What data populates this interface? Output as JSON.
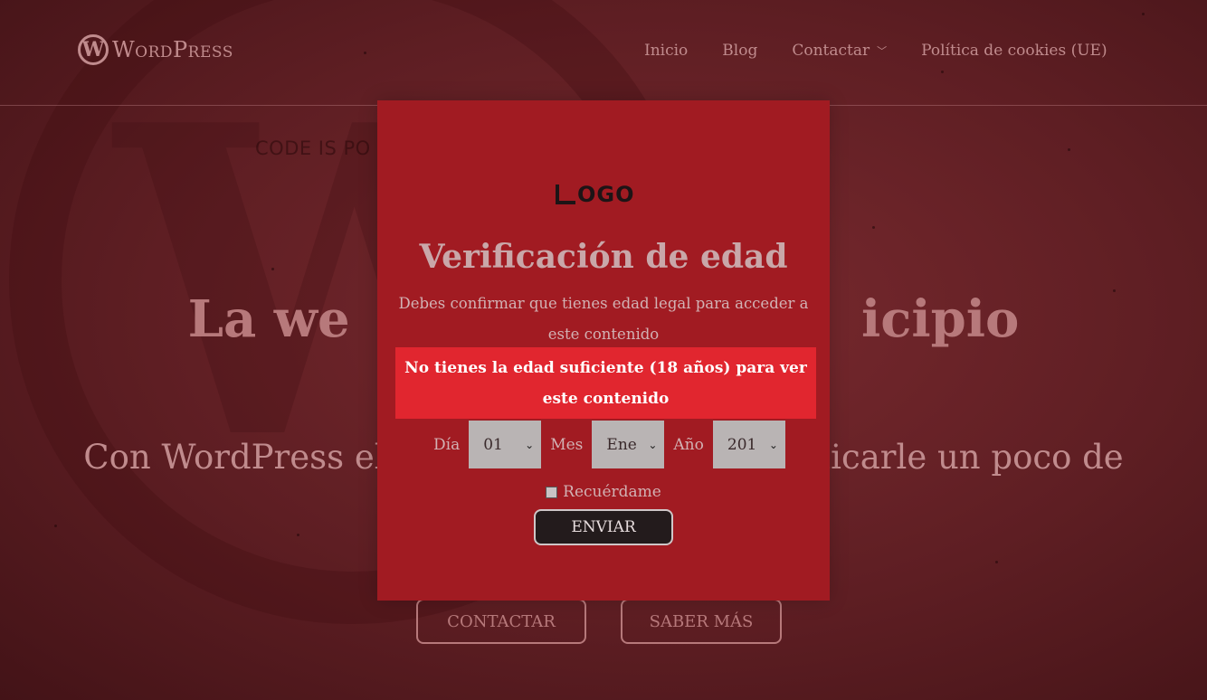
{
  "site": {
    "logo_name": "WordPress",
    "logo_mark": "W",
    "tagline": "CODE IS PO",
    "nav": [
      {
        "label": "Inicio"
      },
      {
        "label": "Blog"
      },
      {
        "label": "Contactar",
        "has_dropdown": true
      },
      {
        "label": "Política de cookies (UE)"
      }
    ]
  },
  "hero": {
    "title": "La we                             icipio",
    "subtitle": "Con WordPress el lím                              dedicarle un poco de",
    "buttons": {
      "contact": "CONTACTAR",
      "more": "SABER MÁS"
    }
  },
  "modal": {
    "logo_text": "OGO",
    "title": "Verificación de edad",
    "description": "Debes confirmar que tienes edad legal para acceder a este contenido",
    "error": "No tienes la edad suficiente (18 años) para ver este contenido",
    "date": {
      "day_label": "Día",
      "day_value": "01",
      "month_label": "Mes",
      "month_value": "Ene",
      "year_label": "Año",
      "year_value": "201"
    },
    "remember_label": "Recuérdame",
    "submit_label": "ENVIAR"
  },
  "colors": {
    "modal_bg": "#a11b22",
    "error_bg": "#e1262f",
    "page_bg": "#5e1d22",
    "button_bg": "#231b1c"
  }
}
